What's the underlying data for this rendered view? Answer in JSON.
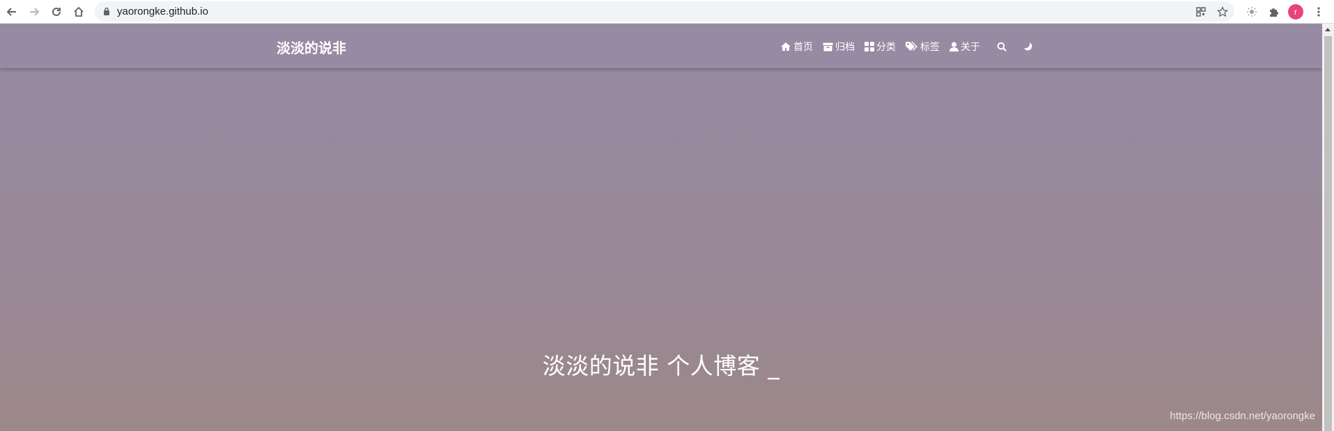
{
  "browser": {
    "url": "yaorongke.github.io",
    "profile_initial": "r",
    "accent_profile_color": "#e8437a"
  },
  "site": {
    "brand": "淡淡的说非",
    "menu": [
      {
        "icon": "home-icon",
        "label": "首页"
      },
      {
        "icon": "archive-icon",
        "label": "归档"
      },
      {
        "icon": "grid-icon",
        "label": "分类"
      },
      {
        "icon": "tags-icon",
        "label": "标签"
      },
      {
        "icon": "user-icon",
        "label": "关于"
      }
    ],
    "search_icon": "search-icon",
    "theme_icon": "moon-icon"
  },
  "hero": {
    "title": "淡淡的说非 个人博客 _"
  },
  "watermark": "https://blog.csdn.net/yaorongke",
  "colors": {
    "header_bg": "#978aa3",
    "gradient_top": "#968aa3",
    "gradient_bottom": "#9c8888"
  }
}
